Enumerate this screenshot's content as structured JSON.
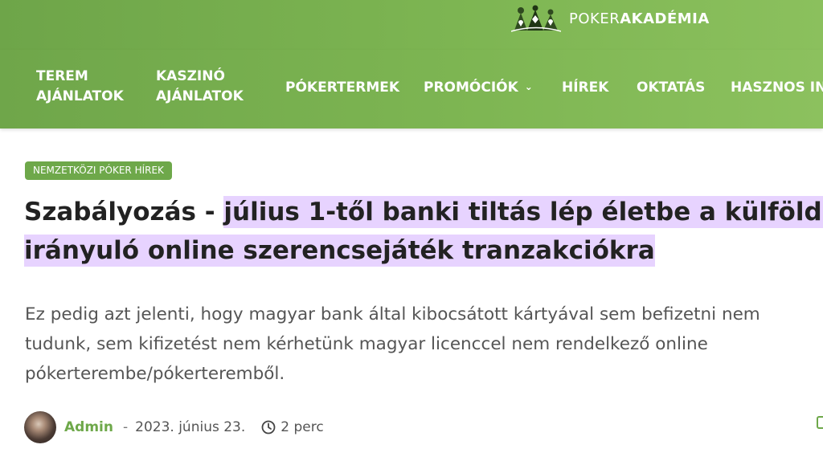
{
  "logo": {
    "prefix": "POKER",
    "suffix": "AKADÉMIA"
  },
  "nav": {
    "terem": "TEREM AJÁNLATOK",
    "kaszino": "KASZINÓ AJÁNLATOK",
    "pokertermek": "PÓKERTERMEK",
    "promociok": "PROMÓCIÓK",
    "hirek": "HÍREK",
    "oktatas": "OKTATÁS",
    "hasznos": "HASZNOS INF"
  },
  "article": {
    "category": "NEMZETKÖZI PÓKER HÍREK",
    "title_plain": "Szabályozás - ",
    "title_highlighted": "július 1-től banki tiltás lép életbe a külföldre irányuló online szerencsejáték tranzakciókra",
    "excerpt": "Ez pedig azt jelenti, hogy magyar bank által kibocsátott kártyával sem befizetni nem tudunk, sem kifizetést nem kérhetünk magyar licenccel nem rendelkező online pókerterembe/pókerteremből.",
    "author": "Admin",
    "separator": "-",
    "date": "2023. június 23.",
    "read_time": "2 perc"
  },
  "colors": {
    "brand_green": "#6ea84a",
    "highlight": "#e7d3ff",
    "title_text": "#222222",
    "body_text": "#555555"
  },
  "icons": {
    "logo": "poker-players-logo-icon",
    "dropdown": "chevron-down-icon",
    "time": "clock-icon",
    "edge": "edit-icon"
  }
}
